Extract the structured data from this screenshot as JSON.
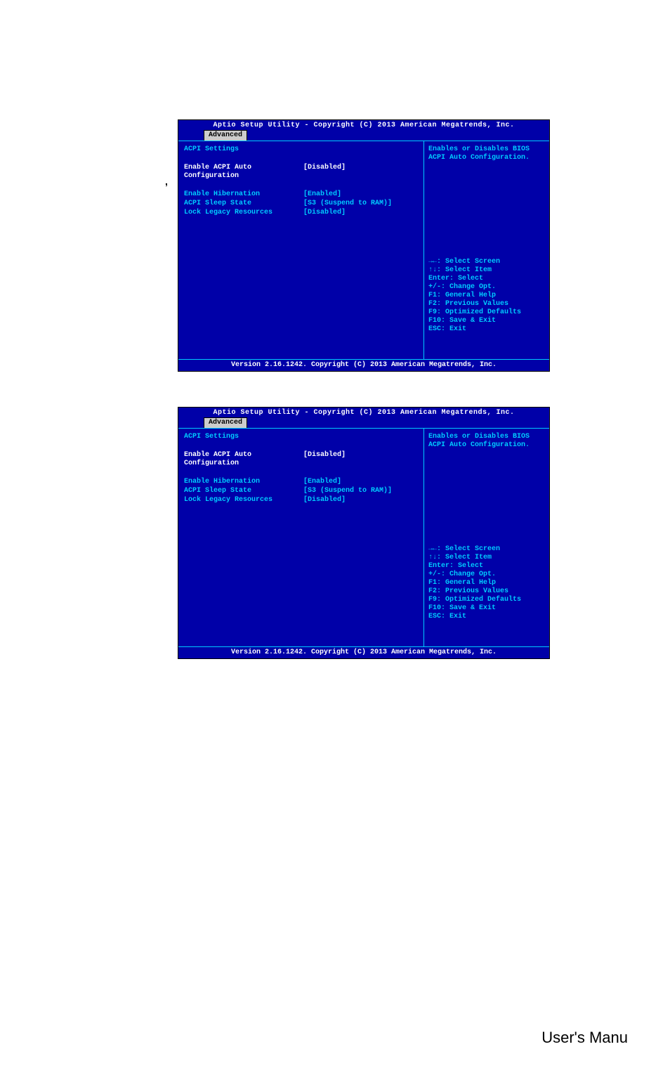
{
  "page": {
    "stray_text": ",",
    "footer_text": "User's Manu"
  },
  "bios": {
    "header": "Aptio Setup Utility - Copyright (C) 2013 American Megatrends, Inc.",
    "tab": "Advanced",
    "section_title": "ACPI Settings",
    "settings": [
      {
        "label": "Enable ACPI Auto Configuration",
        "value": "[Disabled]",
        "highlighted": true
      },
      {
        "label": "Enable Hibernation",
        "value": "[Enabled]",
        "highlighted": false
      },
      {
        "label": "ACPI Sleep State",
        "value": "[S3 (Suspend to RAM)]",
        "highlighted": false
      },
      {
        "label": "Lock Legacy Resources",
        "value": "[Disabled]",
        "highlighted": false
      }
    ],
    "help": "Enables or Disables BIOS ACPI Auto Configuration.",
    "keys": [
      "→←: Select Screen",
      "↑↓: Select Item",
      "Enter: Select",
      "+/-: Change Opt.",
      "F1: General Help",
      "F2: Previous Values",
      "F9: Optimized Defaults",
      "F10: Save & Exit",
      "ESC: Exit"
    ],
    "footer": "Version 2.16.1242. Copyright (C) 2013 American Megatrends, Inc."
  }
}
